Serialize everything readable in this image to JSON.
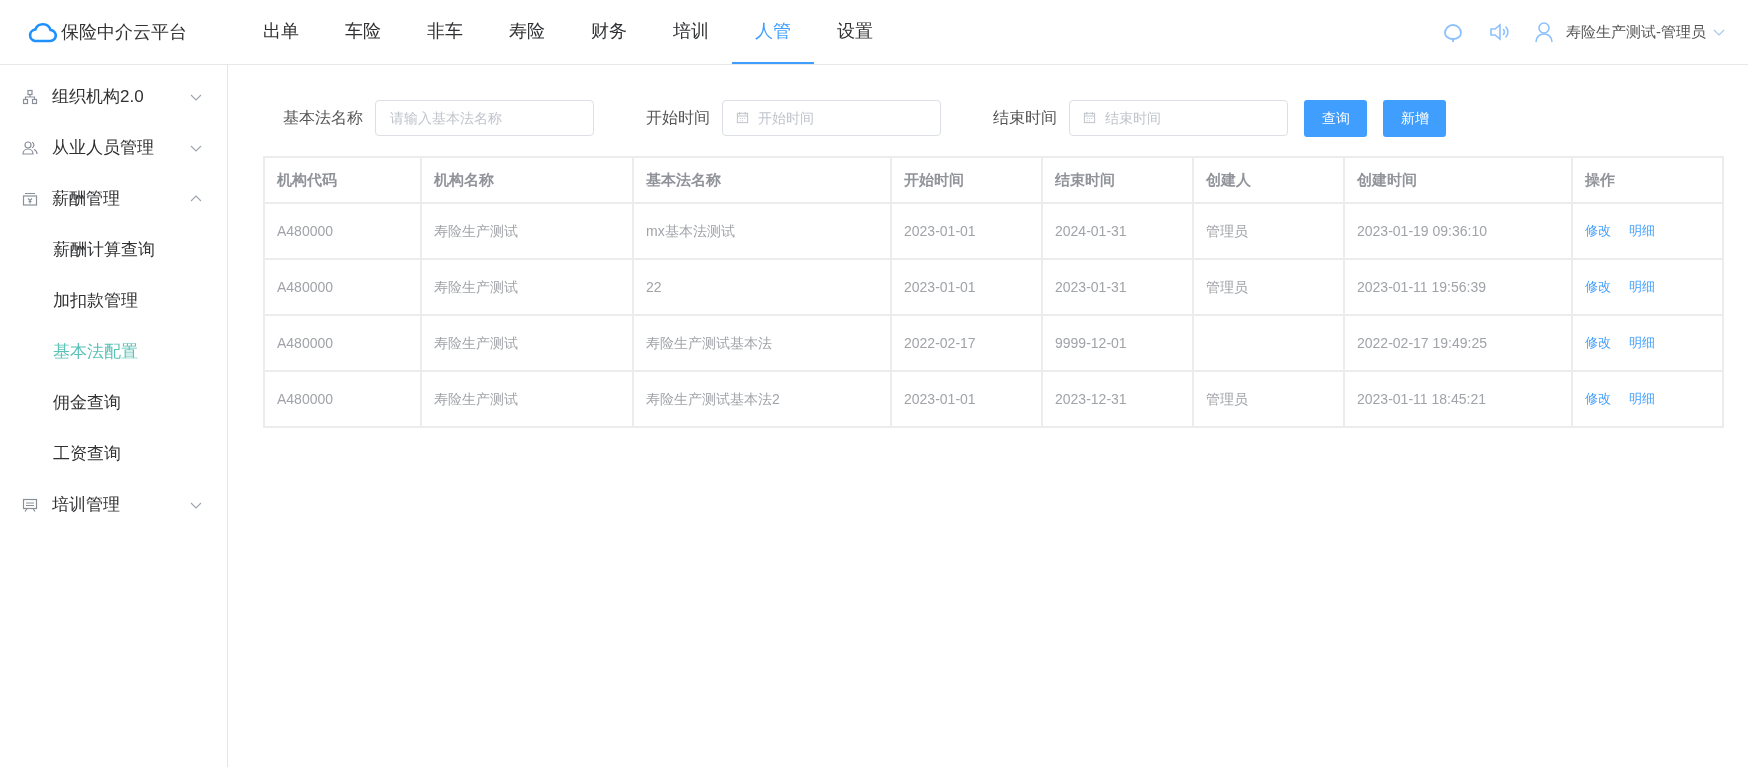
{
  "header": {
    "logo_text": "保险中介云平台",
    "nav": [
      {
        "label": "出单",
        "selected": false
      },
      {
        "label": "车险",
        "selected": false
      },
      {
        "label": "非车",
        "selected": false
      },
      {
        "label": "寿险",
        "selected": false
      },
      {
        "label": "财务",
        "selected": false
      },
      {
        "label": "培训",
        "selected": false
      },
      {
        "label": "人管",
        "selected": true
      },
      {
        "label": "设置",
        "selected": false
      }
    ],
    "user": "寿险生产测试-管理员"
  },
  "sidebar": {
    "items": [
      {
        "label": "组织机构2.0",
        "expanded": false
      },
      {
        "label": "从业人员管理",
        "expanded": false
      },
      {
        "label": "薪酬管理",
        "expanded": true,
        "children": [
          {
            "label": "薪酬计算查询",
            "selected": false
          },
          {
            "label": "加扣款管理",
            "selected": false
          },
          {
            "label": "基本法配置",
            "selected": true
          },
          {
            "label": "佣金查询",
            "selected": false
          },
          {
            "label": "工资查询",
            "selected": false
          }
        ]
      },
      {
        "label": "培训管理",
        "expanded": false
      }
    ]
  },
  "filters": [
    {
      "kind": "text",
      "label": "基本法名称",
      "placeholder": "请输入基本法名称"
    },
    {
      "kind": "date",
      "label": "开始时间",
      "placeholder": "开始时间"
    },
    {
      "kind": "date",
      "label": "结束时间",
      "placeholder": "结束时间"
    }
  ],
  "buttons": [
    "查询",
    "新增"
  ],
  "table": {
    "columns": [
      "机构代码",
      "机构名称",
      "基本法名称",
      "开始时间",
      "结束时间",
      "创建人",
      "创建时间",
      "操作"
    ],
    "rows": [
      {
        "cells": [
          "A480000",
          "寿险生产测试",
          "mx基本法测试",
          "2023-01-01",
          "2024-01-31",
          "管理员",
          "2023-01-19 09:36:10"
        ],
        "actions": [
          "修改",
          "明细"
        ]
      },
      {
        "cells": [
          "A480000",
          "寿险生产测试",
          "22",
          "2023-01-01",
          "2023-01-31",
          "管理员",
          "2023-01-11 19:56:39"
        ],
        "actions": [
          "修改",
          "明细"
        ]
      },
      {
        "cells": [
          "A480000",
          "寿险生产测试",
          "寿险生产测试基本法",
          "2022-02-17",
          "9999-12-01",
          "",
          "2022-02-17 19:49:25"
        ],
        "actions": [
          "修改",
          "明细"
        ]
      },
      {
        "cells": [
          "A480000",
          "寿险生产测试",
          "寿险生产测试基本法2",
          "2023-01-01",
          "2023-12-31",
          "管理员",
          "2023-01-11 18:45:21"
        ],
        "actions": [
          "修改",
          "明细"
        ]
      }
    ]
  }
}
